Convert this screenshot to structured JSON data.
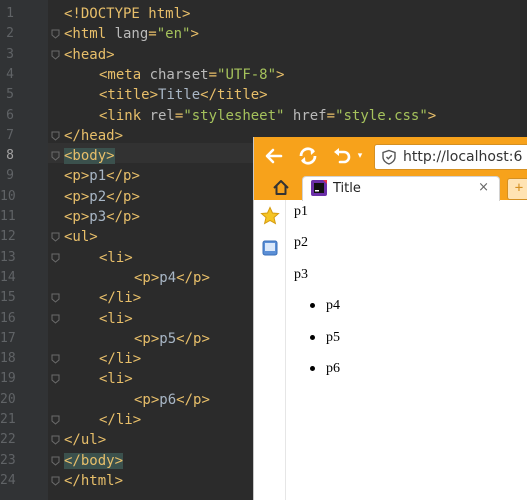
{
  "editor": {
    "line_numbers": [
      "1",
      "2",
      "3",
      "4",
      "5",
      "6",
      "7",
      "8",
      "9",
      "10",
      "11",
      "12",
      "13",
      "14",
      "15",
      "16",
      "17",
      "18",
      "19",
      "20",
      "21",
      "22",
      "23",
      "24"
    ],
    "lines": [
      {
        "indent": 0,
        "parts": [
          [
            "tag",
            "<!DOCTYPE html>"
          ]
        ]
      },
      {
        "indent": 0,
        "parts": [
          [
            "tag",
            "<html "
          ],
          [
            "attr",
            "lang"
          ],
          [
            "tag",
            "="
          ],
          [
            "str",
            "\"en\""
          ],
          [
            "tag",
            ">"
          ]
        ]
      },
      {
        "indent": 0,
        "parts": [
          [
            "tag",
            "<head>"
          ]
        ]
      },
      {
        "indent": 1,
        "parts": [
          [
            "tag",
            "<meta "
          ],
          [
            "attr",
            "charset"
          ],
          [
            "tag",
            "="
          ],
          [
            "str",
            "\"UTF-8\""
          ],
          [
            "tag",
            ">"
          ]
        ]
      },
      {
        "indent": 1,
        "parts": [
          [
            "tag",
            "<title>"
          ],
          [
            "txt",
            "Title"
          ],
          [
            "tag",
            "</title>"
          ]
        ]
      },
      {
        "indent": 1,
        "parts": [
          [
            "tag",
            "<link "
          ],
          [
            "attr",
            "rel"
          ],
          [
            "tag",
            "="
          ],
          [
            "str",
            "\"stylesheet\""
          ],
          [
            "attr",
            " href"
          ],
          [
            "tag",
            "="
          ],
          [
            "str",
            "\"style.css\""
          ],
          [
            "tag",
            ">"
          ]
        ]
      },
      {
        "indent": 0,
        "parts": [
          [
            "tag",
            "</head>"
          ]
        ]
      },
      {
        "indent": 0,
        "parts": [
          [
            "hl",
            "<body>"
          ]
        ]
      },
      {
        "indent": 0,
        "parts": [
          [
            "tag",
            "<p>"
          ],
          [
            "txt",
            "p1"
          ],
          [
            "tag",
            "</p>"
          ]
        ]
      },
      {
        "indent": 0,
        "parts": [
          [
            "tag",
            "<p>"
          ],
          [
            "txt",
            "p2"
          ],
          [
            "tag",
            "</p>"
          ]
        ]
      },
      {
        "indent": 0,
        "parts": [
          [
            "tag",
            "<p>"
          ],
          [
            "txt",
            "p3"
          ],
          [
            "tag",
            "</p>"
          ]
        ]
      },
      {
        "indent": 0,
        "parts": [
          [
            "tag",
            "<ul>"
          ]
        ]
      },
      {
        "indent": 1,
        "parts": [
          [
            "tag",
            "<li>"
          ]
        ]
      },
      {
        "indent": 2,
        "parts": [
          [
            "tag",
            "<p>"
          ],
          [
            "txt",
            "p4"
          ],
          [
            "tag",
            "</p>"
          ]
        ]
      },
      {
        "indent": 1,
        "parts": [
          [
            "tag",
            "</li>"
          ]
        ]
      },
      {
        "indent": 1,
        "parts": [
          [
            "tag",
            "<li>"
          ]
        ]
      },
      {
        "indent": 2,
        "parts": [
          [
            "tag",
            "<p>"
          ],
          [
            "txt",
            "p5"
          ],
          [
            "tag",
            "</p>"
          ]
        ]
      },
      {
        "indent": 1,
        "parts": [
          [
            "tag",
            "</li>"
          ]
        ]
      },
      {
        "indent": 1,
        "parts": [
          [
            "tag",
            "<li>"
          ]
        ]
      },
      {
        "indent": 2,
        "parts": [
          [
            "tag",
            "<p>"
          ],
          [
            "txt",
            "p6"
          ],
          [
            "tag",
            "</p>"
          ]
        ]
      },
      {
        "indent": 1,
        "parts": [
          [
            "tag",
            "</li>"
          ]
        ]
      },
      {
        "indent": 0,
        "parts": [
          [
            "tag",
            "</ul>"
          ]
        ]
      },
      {
        "indent": 0,
        "parts": [
          [
            "hl",
            "</body>"
          ]
        ]
      },
      {
        "indent": 0,
        "parts": [
          [
            "tag",
            "</html>"
          ]
        ]
      }
    ],
    "fold_lines": [
      2,
      3,
      7,
      8,
      12,
      13,
      15,
      16,
      18,
      19,
      21,
      22,
      23,
      24
    ],
    "current_line": 8
  },
  "browser": {
    "url": "http://localhost:6",
    "tab_title": "Title",
    "tab_close": "×",
    "new_tab": "+",
    "colors": {
      "toolbar": "#f7a21b"
    },
    "icons": [
      "back-arrow-icon",
      "reload-icon",
      "undo-icon",
      "shield-icon",
      "home-icon",
      "favicon-icon",
      "star-icon",
      "screen-icon"
    ],
    "content": {
      "paragraphs": [
        "p1",
        "p2",
        "p3"
      ],
      "list_items": [
        "p4",
        "p5",
        "p6"
      ]
    }
  }
}
